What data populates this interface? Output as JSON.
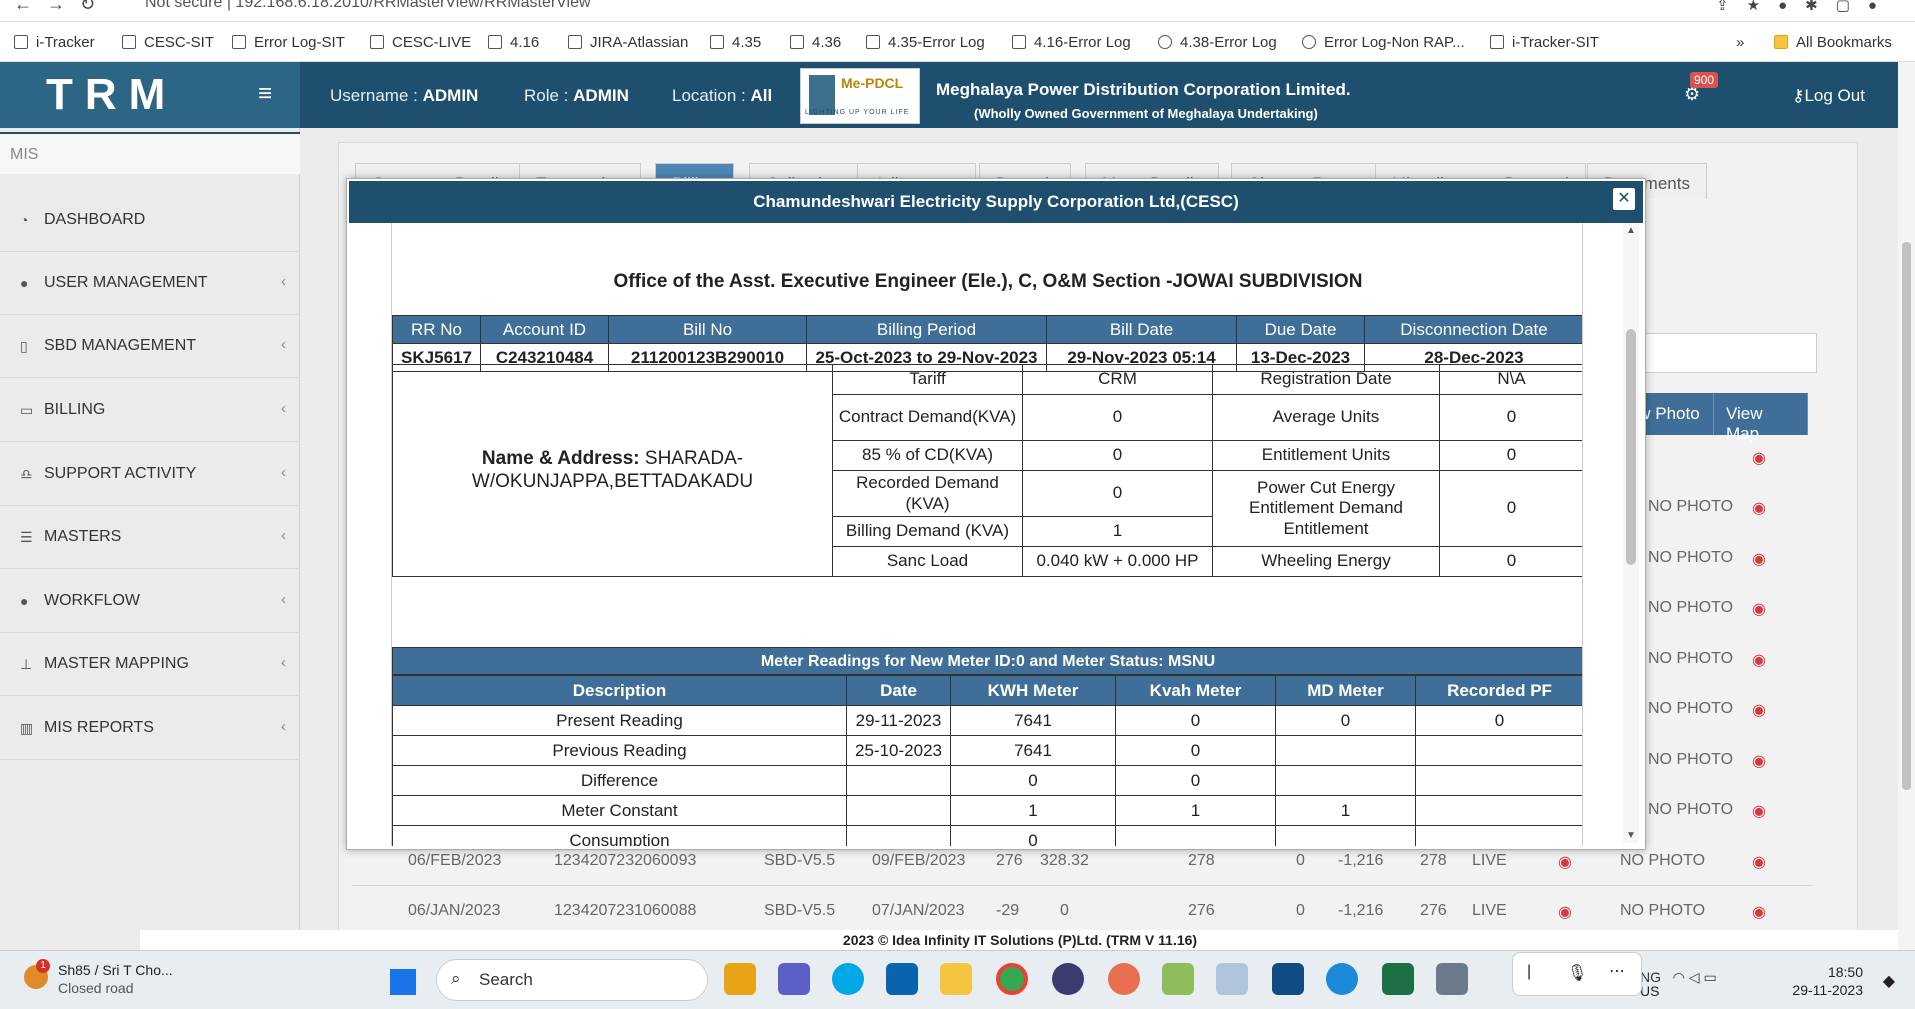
{
  "browser": {
    "url": "Not secure | 192.168.6.18:2010/RRMasterView/RRMasterView",
    "bookmarks": [
      "i-Tracker",
      "CESC-SIT",
      "Error Log-SIT",
      "CESC-LIVE",
      "4.16",
      "JIRA-Atlassian",
      "4.35",
      "4.36",
      "4.35-Error Log",
      "4.16-Error Log",
      "4.38-Error Log",
      "Error Log-Non RAP...",
      "i-Tracker-SIT"
    ],
    "more": "»",
    "all_bookmarks": "All Bookmarks"
  },
  "header": {
    "logo": "TRM",
    "username_label": "Username :",
    "username": "ADMIN",
    "role_label": "Role :",
    "role": "ADMIN",
    "location_label": "Location :",
    "location": "All",
    "brand_mark": "Me-PDCL",
    "brand_tagline": "LIGHTING UP YOUR LIFE",
    "company": "Meghalaya Power Distribution Corporation Limited.",
    "company_sub": "(Wholly Owned Government of Meghalaya Undertaking)",
    "notification_count": "900",
    "logout": "Log Out"
  },
  "sidebar": {
    "section": "MIS",
    "items": [
      {
        "label": "Dashboard",
        "icon": "dashboard-icon"
      },
      {
        "label": "User Management",
        "icon": "user-icon"
      },
      {
        "label": "SBD Management",
        "icon": "mobile-icon"
      },
      {
        "label": "Billing",
        "icon": "monitor-icon"
      },
      {
        "label": "Support Activity",
        "icon": "headset-icon"
      },
      {
        "label": "Masters",
        "icon": "list-icon"
      },
      {
        "label": "Workflow",
        "icon": "user-icon"
      },
      {
        "label": "Master Mapping",
        "icon": "sitemap-icon"
      },
      {
        "label": "MIS Reports",
        "icon": "bar-chart-icon"
      }
    ]
  },
  "tabs": [
    "Consumer Details",
    "Transaction",
    "Billing",
    "Collection",
    "Adjustment",
    "Deposit",
    "Meter Details",
    "Change Request",
    "Miscellaneous Demand",
    "Documents"
  ],
  "background_table": {
    "headers": [
      "View Photo",
      "View Map"
    ],
    "no_photo": "NO PHOTO",
    "rows": [
      {
        "month": "06/FEB/2023",
        "bill_no": "1234207232060093",
        "sbd": "SBD-V5.5",
        "date": "09/FEB/2023",
        "c1": "276",
        "c2": "328.32",
        "c3": "278",
        "c4": "0",
        "c5": "-1,216",
        "c6": "278",
        "status": "LIVE",
        "photo": "NO PHOTO"
      },
      {
        "month": "06/JAN/2023",
        "bill_no": "1234207231060088",
        "sbd": "SBD-V5.5",
        "date": "07/JAN/2023",
        "c1": "-29",
        "c2": "0",
        "c3": "276",
        "c4": "0",
        "c5": "-1,216",
        "c6": "276",
        "status": "LIVE",
        "photo": "NO PHOTO"
      }
    ]
  },
  "modal": {
    "title": "Chamundeshwari Electricity Supply Corporation Ltd,(CESC)",
    "office": "Office of the Asst. Executive Engineer (Ele.), C, O&M Section -JOWAI SUBDIVISION",
    "bill_headers": [
      "RR No",
      "Account ID",
      "Bill No",
      "Billing Period",
      "Bill Date",
      "Due Date",
      "Disconnection Date"
    ],
    "bill_values": [
      "SKJ5617",
      "C243210484",
      "211200123B290010",
      "25-Oct-2023 to 29-Nov-2023",
      "29-Nov-2023 05:14",
      "13-Dec-2023",
      "28-Dec-2023"
    ],
    "name_label": "Name & Address:",
    "name_value": "SHARADA-W/OKUNJAPPA,BETTADAKADU",
    "details": {
      "tariff_label": "Tariff",
      "tariff": "CRM",
      "reg_date_label": "Registration Date",
      "reg_date": "N\\A",
      "contract_demand_label": "Contract Demand(KVA)",
      "contract_demand": "0",
      "avg_units_label": "Average Units",
      "avg_units": "0",
      "cd85_label": "85 % of CD(KVA)",
      "cd85": "0",
      "entitlement_label": "Entitlement Units",
      "entitlement": "0",
      "recorded_demand_label": "Recorded Demand (KVA)",
      "recorded_demand": "0",
      "power_cut_label": "Power Cut Energy Entitlement Demand Entitlement",
      "power_cut": "0",
      "billing_demand_label": "Billing Demand (KVA)",
      "billing_demand": "1",
      "sanc_load_label": "Sanc Load",
      "sanc_load": "0.040 kW + 0.000 HP",
      "wheeling_label": "Wheeling Energy",
      "wheeling": "0"
    },
    "meter_title": "Meter Readings for New Meter ID:0 and Meter Status: MSNU",
    "meter_headers": [
      "Description",
      "Date",
      "KWH Meter",
      "Kvah Meter",
      "MD Meter",
      "Recorded PF"
    ],
    "meter_rows": [
      [
        "Present Reading",
        "29-11-2023",
        "7641",
        "0",
        "0",
        "0"
      ],
      [
        "Previous Reading",
        "25-10-2023",
        "7641",
        "0",
        "",
        ""
      ],
      [
        "Difference",
        "",
        "0",
        "0",
        "",
        ""
      ],
      [
        "Meter Constant",
        "",
        "1",
        "1",
        "1",
        ""
      ],
      [
        "Consumption",
        "",
        "0",
        "",
        "",
        ""
      ]
    ]
  },
  "footer": "2023 © Idea Infinity IT Solutions (P)Ltd. (TRM V 11.16)",
  "taskbar": {
    "weather_badge": "1",
    "weather_line1": "Sh85 / Sri T Cho...",
    "weather_line2": "Closed road",
    "search": "Search",
    "lang1": "NG",
    "lang2": "US",
    "time": "18:50",
    "date": "29-11-2023"
  }
}
